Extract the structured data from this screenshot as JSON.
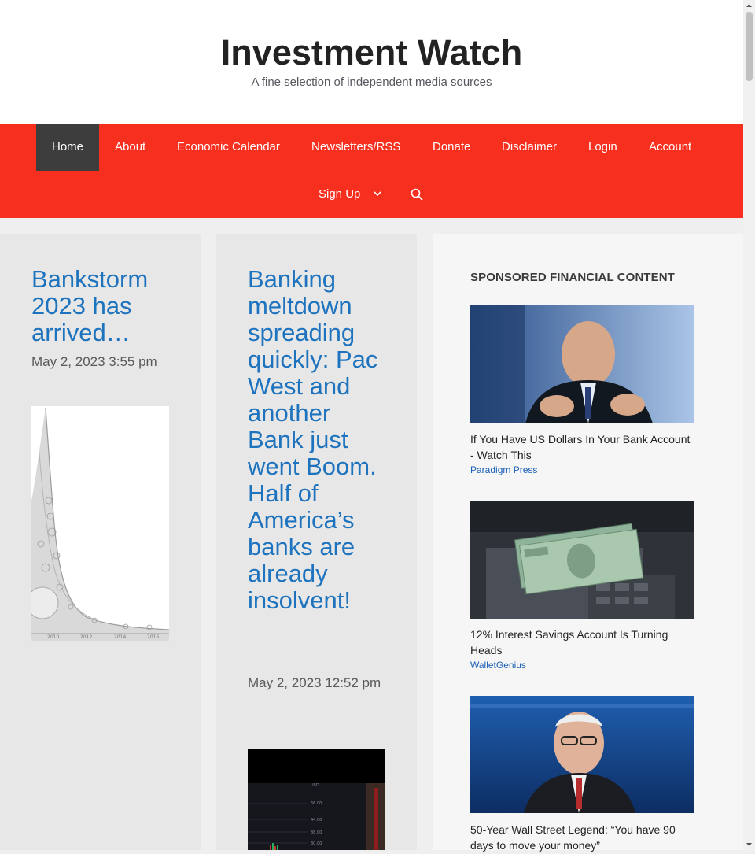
{
  "site": {
    "title": "Investment Watch",
    "description": "A fine selection of independent media sources"
  },
  "nav": {
    "items": [
      {
        "label": "Home",
        "active": true
      },
      {
        "label": "About"
      },
      {
        "label": "Economic Calendar"
      },
      {
        "label": "Newsletters/RSS"
      },
      {
        "label": "Donate"
      },
      {
        "label": "Disclaimer"
      },
      {
        "label": "Login"
      },
      {
        "label": "Account"
      },
      {
        "label": "Sign Up",
        "has_dropdown": true
      }
    ],
    "search_icon": "search-icon",
    "colors": {
      "bar": "#f62f1f",
      "active": "#3d3d3d",
      "text": "#ffffff"
    }
  },
  "posts": [
    {
      "title": "Bankstorm 2023 has arrived…",
      "date": "May 2, 2023 3:55 pm"
    },
    {
      "title": "Banking meltdown spreading quickly: Pac West and another Bank just went Boom. Half of America’s banks are already insolvent!",
      "date": "May 2, 2023 12:52 pm"
    }
  ],
  "sidebar": {
    "heading": "SPONSORED FINANCIAL CONTENT",
    "ads": [
      {
        "title": "If You Have US Dollars In Your Bank Account - Watch This",
        "source": "Paradigm Press"
      },
      {
        "title": "12% Interest Savings Account Is Turning Heads",
        "source": "WalletGenius"
      },
      {
        "title": "50-Year Wall Street Legend: “You have 90 days to move your money”",
        "source": ""
      }
    ]
  },
  "colors": {
    "link": "#1e73be",
    "card": "#e7e7e7",
    "page_bg": "#efefef"
  }
}
